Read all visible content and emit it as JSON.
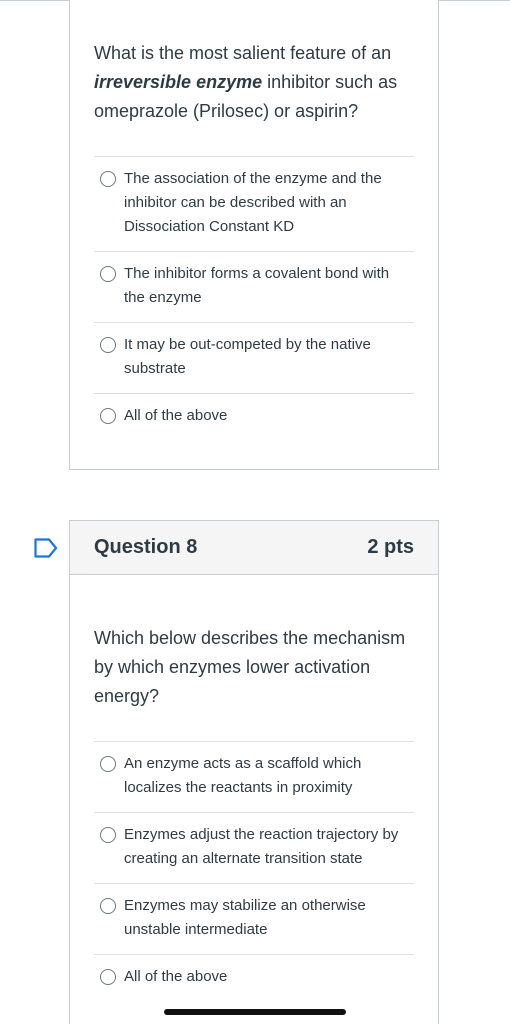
{
  "q7": {
    "text_before": "What is the most salient feature of an ",
    "text_emphasis": "irreversible enzyme",
    "text_after": " inhibitor such as omeprazole (Prilosec) or aspirin?",
    "answers": [
      "The association of the enzyme and the inhibitor can be described with an Dissociation Constant KD",
      "The inhibitor forms a covalent bond with the enzyme",
      "It may be out-competed by the native substrate",
      "All of the above"
    ]
  },
  "q8": {
    "title": "Question 8",
    "points": "2 pts",
    "text": "Which below describes the mechanism by which enzymes lower activation energy?",
    "answers": [
      "An enzyme acts as a scaffold which localizes the reactants in proximity",
      "Enzymes adjust the reaction trajectory by creating an alternate transition state",
      "Enzymes may stabilize an otherwise unstable intermediate",
      "All of the above"
    ]
  },
  "colors": {
    "text": "#2d3b45",
    "border": "#c7cdd1",
    "header_bg": "#f5f5f5",
    "flag": "#1a73e8"
  },
  "icons": {
    "flag": "flag-icon",
    "radio": "radio-icon"
  }
}
